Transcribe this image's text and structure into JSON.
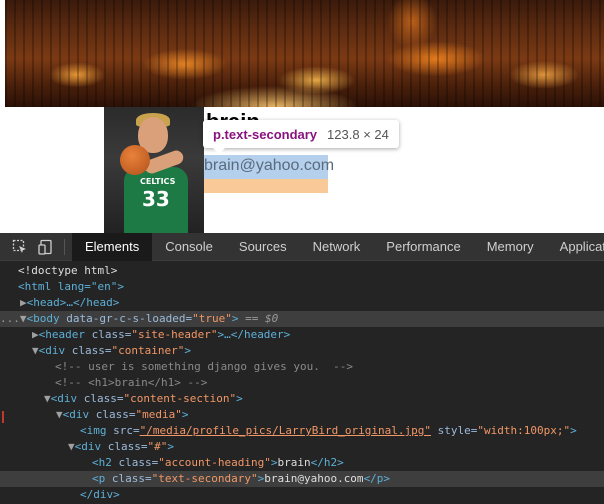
{
  "page": {
    "heading": "brain",
    "email": "brain@yahoo.com",
    "avatar_jersey_text": "CELTICS",
    "avatar_jersey_number": "33"
  },
  "tooltip": {
    "selector": "p.text-secondary",
    "dimensions": "123.8 × 24"
  },
  "devtools": {
    "tabs": [
      {
        "label": "Elements",
        "active": true
      },
      {
        "label": "Console",
        "active": false
      },
      {
        "label": "Sources",
        "active": false
      },
      {
        "label": "Network",
        "active": false
      },
      {
        "label": "Performance",
        "active": false
      },
      {
        "label": "Memory",
        "active": false
      },
      {
        "label": "Application",
        "active": false
      }
    ],
    "dom": {
      "doctype": "<!doctype html>",
      "html_open": "<html lang=\"en\">",
      "head": "<head>…</head>",
      "body_tag": "body",
      "body_attr": "data-gr-c-s-loaded",
      "body_val": "\"true\"",
      "body_suffix": " == $0",
      "header_class": "\"site-header\"",
      "container_class": "\"container\"",
      "comment1": "<!-- user is something django gives you.  -->",
      "comment2": "<!-- <h1>brain</h1> -->",
      "content_class": "\"content-section\"",
      "media_class": "\"media\"",
      "img_src": "\"/media/profile_pics/LarryBird_original.jpg\"",
      "img_style": "\"width:100px;\"",
      "inner_div_class": "\"#\"",
      "h2_class": "\"account-heading\"",
      "h2_text": "brain",
      "p_class": "\"text-secondary\"",
      "p_text": "brain@yahoo.com",
      "div_close": "</div>"
    }
  }
}
